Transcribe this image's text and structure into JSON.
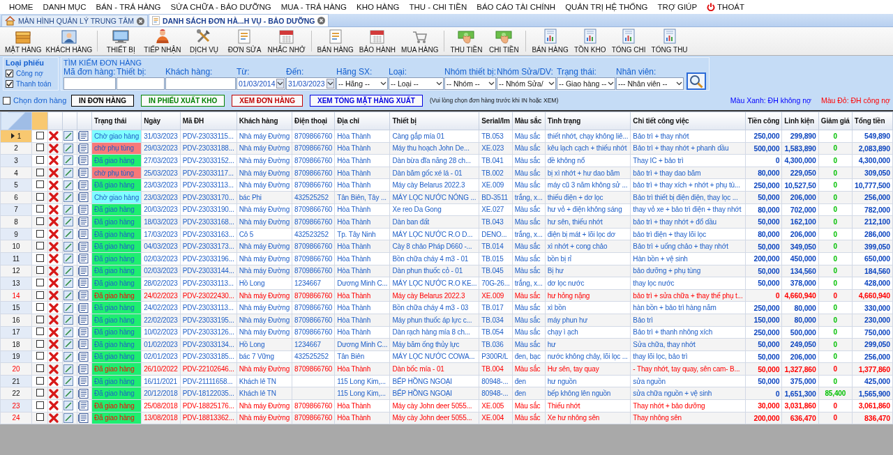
{
  "menu": [
    {
      "label": "HOME",
      "kind": "text"
    },
    {
      "label": "DANH MỤC",
      "kind": "text"
    },
    {
      "label": "BÁN - TRẢ HÀNG",
      "kind": "text"
    },
    {
      "label": "SỬA CHỮA - BẢO DƯỠNG",
      "kind": "text"
    },
    {
      "label": "MUA - TRẢ HÀNG",
      "kind": "text"
    },
    {
      "label": "KHO HÀNG",
      "kind": "text"
    },
    {
      "label": "THU - CHI TIỀN",
      "kind": "text"
    },
    {
      "label": "BÁO CÁO TÀI CHÍNH",
      "kind": "text"
    },
    {
      "label": "QUẢN TRỊ HỆ THỐNG",
      "kind": "text"
    },
    {
      "label": "TRỢ GIÚP",
      "kind": "text"
    },
    {
      "label": "THOÁT",
      "kind": "power"
    }
  ],
  "tabs": [
    {
      "label": "MÀN HÌNH QUẢN LÝ TRUNG TÂM",
      "kind": "home",
      "selected": false
    },
    {
      "label": "DANH SÁCH ĐƠN HÀ...H VỤ - BẢO DƯỠNG",
      "kind": "form",
      "selected": true
    }
  ],
  "toolbar": [
    {
      "items": [
        {
          "label": "MẶT HÀNG",
          "kind": "box"
        },
        {
          "label": "KHÁCH HÀNG",
          "kind": "card"
        }
      ]
    },
    {
      "items": [
        {
          "label": "THIẾT BỊ",
          "kind": "monitor"
        },
        {
          "label": "TIẾP NHẬN",
          "kind": "person"
        },
        {
          "label": "DỊCH VỤ",
          "kind": "tools"
        },
        {
          "label": "ĐƠN SỬA",
          "kind": "form"
        },
        {
          "label": "NHẮC NHỞ",
          "kind": "calendar"
        }
      ]
    },
    {
      "items": [
        {
          "label": "BÁN HÀNG",
          "kind": "form"
        },
        {
          "label": "BẢO HÀNH",
          "kind": "calendar"
        },
        {
          "label": "MUA HÀNG",
          "kind": "cart"
        }
      ]
    },
    {
      "items": [
        {
          "label": "THU TIỀN",
          "kind": "cash"
        },
        {
          "label": "CHI TIỀN",
          "kind": "cash"
        }
      ]
    },
    {
      "items": [
        {
          "label": "BÁN HÀNG",
          "kind": "report"
        },
        {
          "label": "TỒN KHO",
          "kind": "report"
        },
        {
          "label": "TỔNG CHI",
          "kind": "report"
        },
        {
          "label": "TỔNG THU",
          "kind": "report"
        }
      ]
    }
  ],
  "ticket_type": {
    "title": "Loại phiếu",
    "options": [
      {
        "label": "Công nợ",
        "checked": true
      },
      {
        "label": "Thanh toán",
        "checked": true
      }
    ]
  },
  "search": {
    "title": "TÌM KIẾM ĐƠN HÀNG",
    "fields": [
      {
        "label": "Mã đơn hàng:",
        "kind": "text"
      },
      {
        "label": "Thiết bị:",
        "kind": "text"
      },
      {
        "label": "Khách hàng:",
        "kind": "text"
      },
      {
        "label": "Từ:",
        "kind": "date",
        "value": "01/03/2014"
      },
      {
        "label": "Đến:",
        "kind": "date",
        "value": "31/03/2023"
      },
      {
        "label": "Hãng SX:",
        "kind": "select",
        "value": "-- Hãng --"
      },
      {
        "label": "Loại:",
        "kind": "select",
        "value": "-- Loại --"
      },
      {
        "label": "Nhóm thiết bị:",
        "kind": "select",
        "value": "-- Nhóm --"
      },
      {
        "label": "Nhóm Sửa/DV:",
        "kind": "select",
        "value": "-- Nhóm Sửa/"
      },
      {
        "label": "Trạng thái:",
        "kind": "select",
        "value": "-- Giao hàng --"
      },
      {
        "label": "Nhân viên:",
        "kind": "select",
        "value": "--- Nhân viên --"
      }
    ]
  },
  "select_orders": {
    "label": "Chọn đơn hàng",
    "checked": false
  },
  "actions": [
    {
      "label": "IN ĐƠN HÀNG",
      "color": "#000000"
    },
    {
      "label": "IN PHIẾU XUẤT KHO",
      "color": "#008000"
    },
    {
      "label": "XEM ĐƠN HÀNG",
      "color": "#c00000"
    },
    {
      "label": "XEM TỔNG MẶT HÀNG XUẤT",
      "color": "#0000e0"
    }
  ],
  "note": "(Vui lòng chọn đơn hàng trước khi IN hoặc XEM)",
  "legend": [
    {
      "label": "Màu Xanh: ĐH không nợ",
      "color": "#0000ff"
    },
    {
      "label": "Màu Đỏ:  ĐH công nợ",
      "color": "#ff0000"
    }
  ],
  "table": {
    "columns": [
      "Trạng thái",
      "Ngày",
      "Mã ĐH",
      "Khách hàng",
      "Điện thoại",
      "Địa chỉ",
      "Thiết bị",
      "Serial/Im",
      "Màu sắc",
      "Tình trạng",
      "Chi tiết công việc",
      "Tiền công",
      "Linh kiện",
      "Giảm giá",
      "Tổng tiền"
    ],
    "rows": [
      {
        "no": "1",
        "selected": true,
        "checked": false,
        "debt": false,
        "color": "#80ffff",
        "cells": [
          "Chờ giao hàng",
          "31/03/2023",
          "PDV-23033115...",
          "Nhà máy Đường",
          "8709866760",
          "Hòa Thành",
          "Càng gắp mía 01",
          "TB.053",
          "Màu sắc",
          "thiết nhớt, chạy không liê...",
          "Bảo trì + thay nhớt",
          "250,000",
          "299,890",
          "0",
          "549,890"
        ]
      },
      {
        "no": "2",
        "selected": false,
        "checked": false,
        "debt": false,
        "color": "#f87878",
        "cells": [
          "chờ phụ tùng",
          "29/03/2023",
          "PDV-23033188...",
          "Nhà máy Đường",
          "8709866760",
          "Hòa Thành",
          "Máy thu hoạch John De...",
          "XE.023",
          "Màu sắc",
          "kêu lạch cạch + thiếu nhớt",
          "Bảo trì + thay nhớt + phanh dầu",
          "500,000",
          "1,583,890",
          "0",
          "2,083,890"
        ]
      },
      {
        "no": "3",
        "selected": false,
        "checked": false,
        "debt": false,
        "color": "#1eee70",
        "cells": [
          "Đã giao hàng",
          "27/03/2023",
          "PDV-23033152...",
          "Nhà máy Đường",
          "8709866760",
          "Hòa Thành",
          "Dàn bừa đĩa năng 28 ch...",
          "TB.041",
          "Màu sắc",
          "đề không nổ",
          "Thay IC + bảo trì",
          "0",
          "4,300,000",
          "0",
          "4,300,000"
        ]
      },
      {
        "no": "4",
        "selected": false,
        "checked": false,
        "debt": false,
        "color": "#f87878",
        "cells": [
          "chờ phụ tùng",
          "25/03/2023",
          "PDV-23033117...",
          "Nhà máy Đường",
          "8709866760",
          "Hòa Thành",
          "Dàn băm gốc xé lá - 01",
          "TB.002",
          "Màu sắc",
          "bị xì nhớt + hư dao băm",
          "bảo trì + thay dao băm",
          "80,000",
          "229,050",
          "0",
          "309,050"
        ]
      },
      {
        "no": "5",
        "selected": false,
        "checked": false,
        "debt": false,
        "color": "#1eee70",
        "cells": [
          "Đã giao hàng",
          "23/03/2023",
          "PDV-23033113...",
          "Nhà máy Đường",
          "8709866760",
          "Hòa Thành",
          "Máy cày Belarus 2022.3",
          "XE.009",
          "Màu sắc",
          "máy cũ 3 năm không sử ...",
          "bảo trì + thay xích + nhớt  + phụ tù...",
          "250,000",
          "10,527,50",
          "0",
          "10,777,500"
        ]
      },
      {
        "no": "6",
        "selected": false,
        "checked": false,
        "debt": false,
        "color": "#80ffff",
        "cells": [
          "Chờ giao hàng",
          "23/03/2023",
          "PDV-23033170...",
          "bác Phi",
          "432525252",
          "Tân Biên, Tây ...",
          "MÁY LỌC NƯỚC NÓNG ...",
          "BD-3511",
          "trắng, x...",
          "thiếu điện + dơ lọc",
          "Bảo trì thiết bị điện điện, thay lọc ...",
          "50,000",
          "206,000",
          "0",
          "256,000"
        ]
      },
      {
        "no": "7",
        "selected": false,
        "checked": false,
        "debt": false,
        "color": "#1eee70",
        "cells": [
          "Đã giao hàng",
          "20/03/2023",
          "PDV-23033190...",
          "Nhà máy Đường",
          "8709866760",
          "Hòa Thành",
          "Xe reo Da Gong",
          "XE.027",
          "Màu sắc",
          "hư vỏ + điện không sáng",
          "thay vỏ xe + bảo trì điện + thay nhớt",
          "80,000",
          "702,000",
          "0",
          "782,000"
        ]
      },
      {
        "no": "8",
        "selected": false,
        "checked": false,
        "debt": false,
        "color": "#1eee70",
        "cells": [
          "Đã giao hàng",
          "18/03/2023",
          "PDV-23033168...",
          "Nhà máy Đường",
          "8709866760",
          "Hòa Thành",
          "Dàn ban đất",
          "TB.043",
          "Màu sắc",
          "hư sên, thiếu nhớt",
          "bảo trì + thay nhớt + đổ dầu",
          "50,000",
          "162,100",
          "0",
          "212,100"
        ]
      },
      {
        "no": "9",
        "selected": false,
        "checked": false,
        "debt": false,
        "color": "#1eee70",
        "cells": [
          "Đã giao hàng",
          "17/03/2023",
          "PDV-23033163...",
          "Cô 5",
          "432523252",
          "Tp. Tây Ninh",
          "MÁY LỌC NƯỚC R.O D...",
          "DENO...",
          "trắng, x...",
          "điện bị mát + lõi lọc dơ",
          "bảo trì điện + thay lõi lọc",
          "80,000",
          "206,000",
          "0",
          "286,000"
        ]
      },
      {
        "no": "10",
        "selected": false,
        "checked": false,
        "debt": false,
        "color": "#1eee70",
        "cells": [
          "Đã giao hàng",
          "04/03/2023",
          "PDV-23033173...",
          "Nhà máy Đường",
          "8709866760",
          "Hòa Thành",
          "Cày 8 chảo Pháp D660 -...",
          "TB.014",
          "Màu sắc",
          "xì nhớt + cong chảo",
          "Bảo trì + uống chảo + thay nhớt",
          "50,000",
          "349,050",
          "0",
          "399,050"
        ]
      },
      {
        "no": "11",
        "selected": false,
        "checked": false,
        "debt": false,
        "color": "#1eee70",
        "cells": [
          "Đã giao hàng",
          "02/03/2023",
          "PDV-23033196...",
          "Nhà máy Đường",
          "8709866760",
          "Hòa Thành",
          "Bồn chữa cháy 4 m3 - 01",
          "TB.015",
          "Màu sắc",
          "bồn bị rỉ",
          "Hàn bồn + vệ sinh",
          "200,000",
          "450,000",
          "0",
          "650,000"
        ]
      },
      {
        "no": "12",
        "selected": false,
        "checked": false,
        "debt": false,
        "color": "#1eee70",
        "cells": [
          "Đã giao hàng",
          "02/03/2023",
          "PDV-23033144...",
          "Nhà máy Đường",
          "8709866760",
          "Hòa Thành",
          "Dàn phun thuốc cỏ - 01",
          "TB.045",
          "Màu sắc",
          "Bị hư",
          "bảo dưỡng + phụ tùng",
          "50,000",
          "134,560",
          "0",
          "184,560"
        ]
      },
      {
        "no": "13",
        "selected": false,
        "checked": false,
        "debt": false,
        "color": "#1eee70",
        "cells": [
          "Đã giao hàng",
          "28/02/2023",
          "PDV-23033113...",
          "Hồ Long",
          "1234667",
          "Dương Minh C...",
          "MÁY LỌC NƯỚC R.O KE...",
          "70G-26...",
          "trắng, x...",
          "dơ lọc nước",
          "thay lọc nước",
          "50,000",
          "378,000",
          "0",
          "428,000"
        ]
      },
      {
        "no": "14",
        "selected": false,
        "checked": false,
        "debt": true,
        "color": "#1eee70",
        "cells": [
          "Đã giao hàng",
          "24/02/2023",
          "PDV-23022430...",
          "Nhà máy Đường",
          "8709866760",
          "Hòa Thành",
          "Máy cày Belarus 2022.3",
          "XE.009",
          "Màu sắc",
          "hư hỏng nặng",
          "bảo trì + sửa chữa + thay thế phụ t...",
          "0",
          "4,660,940",
          "0",
          "4,660,940"
        ]
      },
      {
        "no": "15",
        "selected": false,
        "checked": false,
        "debt": false,
        "color": "#1eee70",
        "cells": [
          "Đã giao hàng",
          "24/02/2023",
          "PDV-23033113...",
          "Nhà máy Đường",
          "8709866760",
          "Hòa Thành",
          "Bồn chữa cháy 4 m3 - 03",
          "TB.017",
          "Màu sắc",
          "xì bồn",
          "hàn bồn + bảo trì hàng năm",
          "250,000",
          "80,000",
          "0",
          "330,000"
        ]
      },
      {
        "no": "16",
        "selected": false,
        "checked": false,
        "debt": false,
        "color": "#1eee70",
        "cells": [
          "Đã giao hàng",
          "22/02/2023",
          "PDV-23033195...",
          "Nhà máy Đường",
          "8709866760",
          "Hòa Thành",
          "Máy phun thuốc áp lực c...",
          "TB.034",
          "Màu sắc",
          "máy phun hư",
          "Bảo trì",
          "150,000",
          "80,000",
          "0",
          "230,000"
        ]
      },
      {
        "no": "17",
        "selected": false,
        "checked": false,
        "debt": false,
        "color": "#1eee70",
        "cells": [
          "Đã giao hàng",
          "10/02/2023",
          "PDV-23033126...",
          "Nhà máy Đường",
          "8709866760",
          "Hòa Thành",
          "Dàn rạch hàng mía 8 ch...",
          "TB.054",
          "Màu sắc",
          "chạy ì ạch",
          "Bảo trì + thanh nhông xích",
          "250,000",
          "500,000",
          "0",
          "750,000"
        ]
      },
      {
        "no": "18",
        "selected": false,
        "checked": false,
        "debt": false,
        "color": "#1eee70",
        "cells": [
          "Đã giao hàng",
          "01/02/2023",
          "PDV-23033134...",
          "Hồ Long",
          "1234667",
          "Dương Minh C...",
          "Máy băm ống thủy lực",
          "TB.036",
          "Màu sắc",
          "hư",
          "Sửa chữa, thay nhớt",
          "50,000",
          "249,050",
          "0",
          "299,050"
        ]
      },
      {
        "no": "19",
        "selected": false,
        "checked": false,
        "debt": false,
        "color": "#1eee70",
        "cells": [
          "Đã giao hàng",
          "02/01/2023",
          "PDV-23033185...",
          "bác 7 Vững",
          "432525252",
          "Tân Biên",
          "MÁY LỌC NƯỚC COWA...",
          "P300R/L",
          "đen, bạc",
          "nước không chảy, lõi lọc ...",
          "thay lõi lọc, bảo trì",
          "50,000",
          "206,000",
          "0",
          "256,000"
        ]
      },
      {
        "no": "20",
        "selected": false,
        "checked": false,
        "debt": true,
        "color": "#1eee70",
        "cells": [
          "Đã giao hàng",
          "26/10/2022",
          "PDV-22102646...",
          "Nhà máy Đường",
          "8709866760",
          "Hòa Thành",
          "Dàn bốc mía - 01",
          "TB.004",
          "Màu sắc",
          "Hư sên, tay quay",
          "- Thay nhớt, tay quay, sên cam- B...",
          "50,000",
          "1,327,860",
          "0",
          "1,377,860"
        ]
      },
      {
        "no": "21",
        "selected": false,
        "checked": false,
        "debt": false,
        "color": "#1eee70",
        "cells": [
          "Đã giao hàng",
          "16/11/2021",
          "PDV-21111658...",
          "Khách lẻ TN",
          null,
          "115 Long Kim,...",
          "BẾP HỒNG NGOẠI",
          "80948-...",
          "đen",
          "hư nguồn",
          "sửa nguồn",
          "50,000",
          "375,000",
          "0",
          "425,000"
        ]
      },
      {
        "no": "22",
        "selected": false,
        "checked": false,
        "debt": false,
        "color": "#1eee70",
        "cells": [
          "Đã giao hàng",
          "20/12/2018",
          "PDV-18122035...",
          "Khách lẻ TN",
          null,
          "115 Long Kim,...",
          "BẾP HỒNG NGOẠI",
          "80948-...",
          "đen",
          "bếp không lên nguồn",
          "sửa chữa nguồn + vệ sinh",
          "0",
          "1,651,300",
          "85,400",
          "1,565,900"
        ]
      },
      {
        "no": "23",
        "selected": false,
        "checked": false,
        "debt": true,
        "color": "#1eee70",
        "cells": [
          "Đã giao hàng",
          "25/08/2018",
          "PDV-18825176...",
          "Nhà máy Đường",
          "8709866760",
          "Hòa Thành",
          "Máy cày John deer 5055...",
          "XE.005",
          "Màu sắc",
          "Thiếu nhớt",
          "Thay nhớt + bảo dưỡng",
          "30,000",
          "3,031,860",
          "0",
          "3,061,860"
        ]
      },
      {
        "no": "24",
        "selected": false,
        "checked": false,
        "debt": true,
        "color": "#1eee70",
        "cells": [
          "Đã giao hàng",
          "13/08/2018",
          "PDV-18813362...",
          "Nhà máy Đường",
          "8709866760",
          "Hòa Thành",
          "Máy cày John deer 5055...",
          "XE.004",
          "Màu sắc",
          "Xe hư nhông sên",
          "Thay nhông sên",
          "200,000",
          "636,470",
          "0",
          "836,470"
        ]
      }
    ]
  }
}
